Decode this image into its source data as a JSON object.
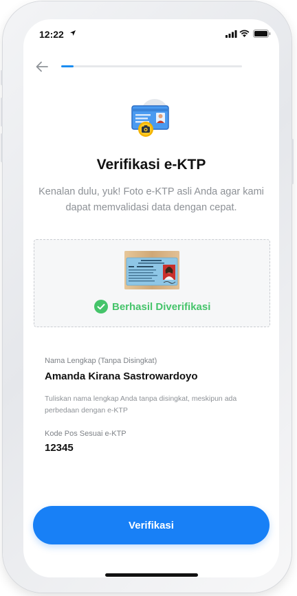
{
  "status_bar": {
    "time": "12:22",
    "icons": [
      "location-arrow-icon",
      "signal-icon",
      "wifi-icon",
      "battery-icon"
    ]
  },
  "nav": {
    "back_icon": "arrow-left-icon",
    "progress_fraction": 0.07
  },
  "header": {
    "illustration": "id-card-camera-icon",
    "title": "Verifikasi e-KTP",
    "subtitle": "Kenalan dulu, yuk! Foto e-KTP asli Anda agar kami dapat memvalidasi data dengan cepat."
  },
  "upload": {
    "thumbnail": "ktp-photo",
    "status_icon": "check-circle-icon",
    "status_label": "Berhasil Diverifikasi"
  },
  "form": {
    "name_label": "Nama Lengkap (Tanpa Disingkat)",
    "name_value": "Amanda Kirana Sastrowardoyo",
    "name_hint": "Tuliskan nama lengkap Anda tanpa disingkat, meskipun ada perbedaan dengan e-KTP",
    "postal_label": "Kode Pos Sesuai e-KTP",
    "postal_value": "12345"
  },
  "actions": {
    "submit_label": "Verifikasi"
  },
  "colors": {
    "accent": "#1880f6",
    "success": "#45c46a",
    "text_primary": "#111111",
    "text_secondary": "#8d9196"
  }
}
